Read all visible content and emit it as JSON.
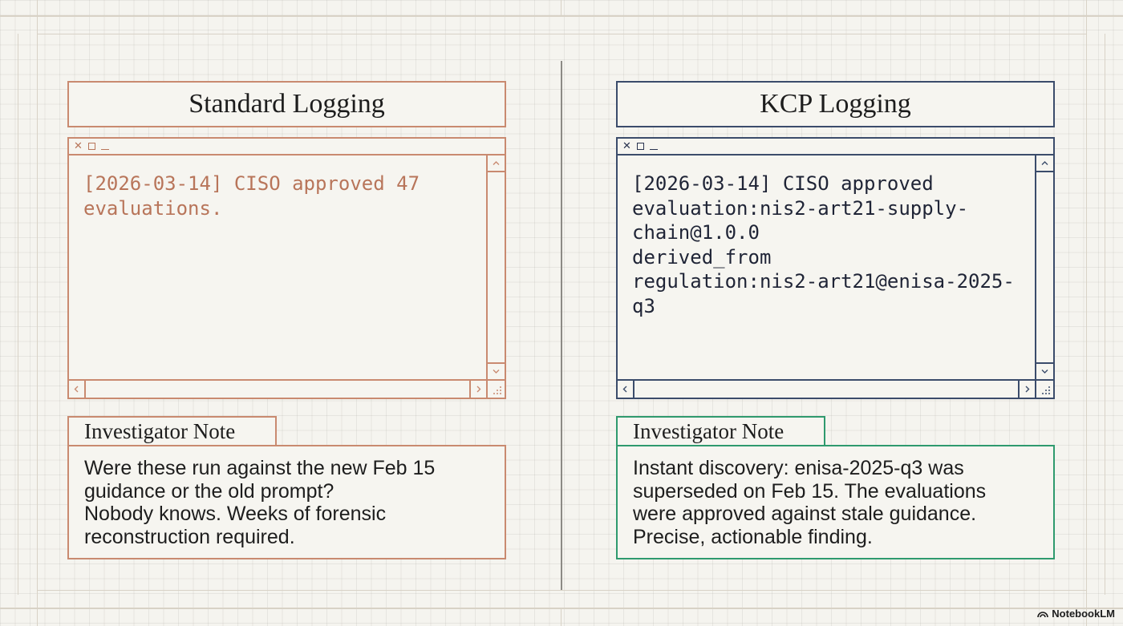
{
  "colors": {
    "standard_accent": "#c98a70",
    "kcp_accent": "#3b4c6b",
    "kcp_note_accent": "#2f9a6e",
    "standard_log_text": "#b8755a",
    "kcp_log_text": "#1f2436"
  },
  "left_panel": {
    "title": "Standard Logging",
    "window": {
      "controls": [
        "close-icon",
        "maximize-icon",
        "minimize-icon"
      ],
      "log_text": "[2026-03-14] CISO approved 47\nevaluations."
    },
    "note": {
      "label": "Investigator Note",
      "lines": [
        "Were these run against the new Feb 15",
        "guidance or the old prompt?",
        "Nobody knows. Weeks of forensic",
        "reconstruction required."
      ]
    }
  },
  "right_panel": {
    "title": "KCP Logging",
    "window": {
      "controls": [
        "close-icon",
        "maximize-icon",
        "minimize-icon"
      ],
      "log_text": "[2026-03-14] CISO approved\nevaluation:nis2-art21-supply-\nchain@1.0.0\nderived_from\nregulation:nis2-art21@enisa-2025-\nq3"
    },
    "note": {
      "label": "Investigator Note",
      "lines": [
        "Instant discovery: enisa-2025-q3 was",
        "superseded on Feb 15. The evaluations",
        "were approved against stale guidance.",
        "Precise, actionable finding."
      ]
    }
  },
  "brand": {
    "name": "NotebookLM"
  }
}
